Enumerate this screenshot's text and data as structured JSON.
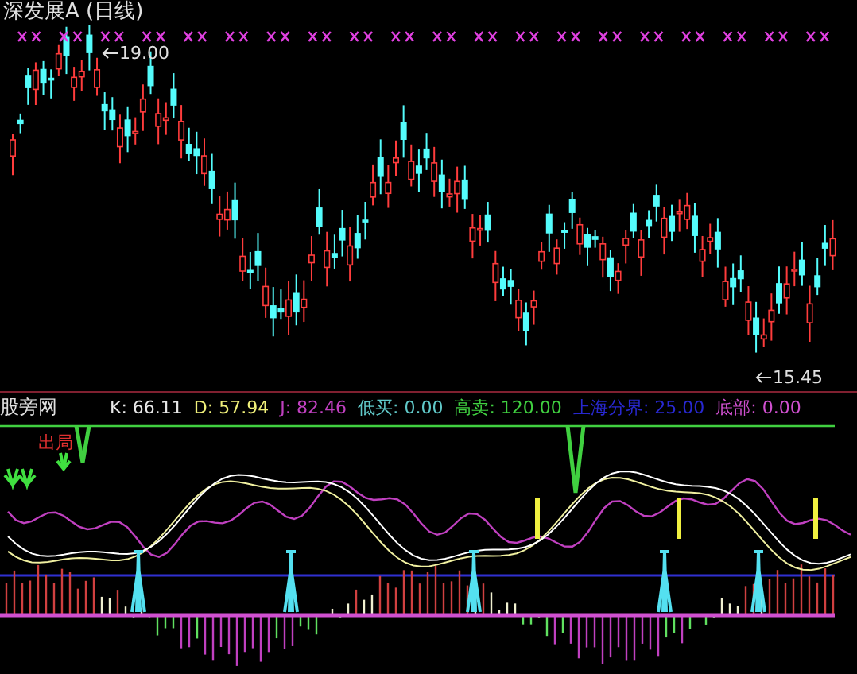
{
  "main_panel": {
    "title": "深发展A (日线)",
    "high_label": "19.00",
    "low_label": "15.45"
  },
  "indicator_panel": {
    "name": "股旁网",
    "sell_label": "出局",
    "readouts": [
      {
        "text": "K: 66.11",
        "color": "#e8e8e8"
      },
      {
        "text": "D: 57.94",
        "color": "#f0f07a"
      },
      {
        "text": "J: 82.46",
        "color": "#c040c0"
      },
      {
        "text": "低买: 0.00",
        "color": "#60c8c8"
      },
      {
        "text": "高卖: 120.00",
        "color": "#40d040"
      },
      {
        "text": "上海分界: 25.00",
        "color": "#2828d0"
      },
      {
        "text": "底部: 0.00",
        "color": "#d050d0"
      }
    ]
  }
}
